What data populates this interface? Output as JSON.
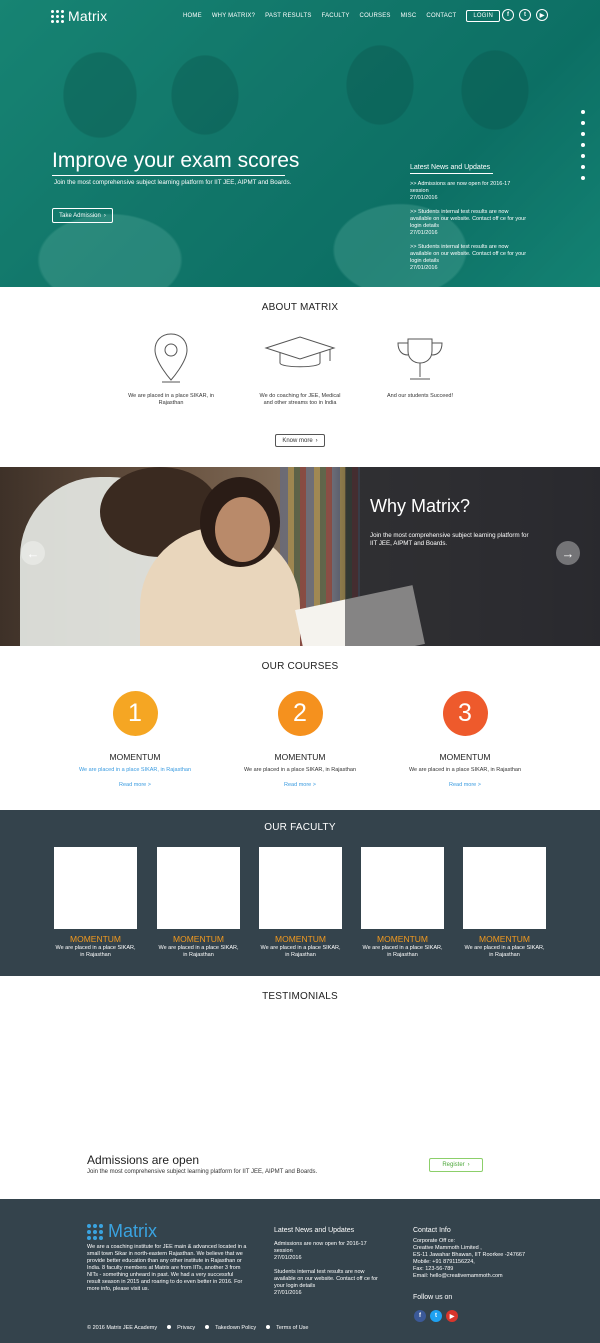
{
  "header": {
    "logo": "Matrix",
    "nav": [
      "HOME",
      "WHY MATRIX?",
      "PAST RESULTS",
      "FACULTY",
      "COURSES",
      "MISC",
      "CONTACT"
    ],
    "login": "LOGIN",
    "social": [
      "f",
      "t",
      "▶"
    ]
  },
  "hero": {
    "title": "Improve your exam scores",
    "subtitle": "Join the most comprehensive subject learning platform for IIT JEE, AIPMT and Boards.",
    "button": "Take Admission",
    "news_title": "Latest News and Updates",
    "news": [
      ">> Admissions are now open for 2016-17 session",
      "27/01/2016",
      ">> Students internal test results are now available on our website. Contact off ce for your login details",
      "27/01/2016",
      ">> Students internal test results are now available on our website. Contact off ce for your login details",
      "27/01/2016"
    ]
  },
  "about": {
    "title": "ABOUT MATRIX",
    "items": [
      "We are placed in a place SIKAR, in Rajasthan",
      "We do coaching for JEE, Medical and other streams too in India",
      "And our students Succeed!"
    ],
    "button": "Know more"
  },
  "why": {
    "title": "Why Matrix?",
    "subtitle": "Join the most comprehensive subject learning platform for IIT JEE, AIPMT and Boards."
  },
  "courses": {
    "title": "OUR COURSES",
    "items": [
      {
        "num": "1",
        "name": "MOMENTUM",
        "desc": "We are placed in a place SIKAR, in Rajasthan",
        "more": "Read more >",
        "color": "#f5a623"
      },
      {
        "num": "2",
        "name": "MOMENTUM",
        "desc": "We are placed in a place SIKAR, in Rajasthan",
        "more": "Read more >",
        "color": "#f5911e"
      },
      {
        "num": "3",
        "name": "MOMENTUM",
        "desc": "We are placed in a place SIKAR, in Rajasthan",
        "more": "Read more >",
        "color": "#ee5a2c"
      }
    ]
  },
  "faculty": {
    "title": "OUR FACULTY",
    "items": [
      {
        "name": "MOMENTUM",
        "desc": "We are placed in a place SIKAR, in Rajasthan"
      },
      {
        "name": "MOMENTUM",
        "desc": "We are placed in a place SIKAR, in Rajasthan"
      },
      {
        "name": "MOMENTUM",
        "desc": "We are placed in a place SIKAR, in Rajasthan"
      },
      {
        "name": "MOMENTUM",
        "desc": "We are placed in a place SIKAR, in Rajasthan"
      },
      {
        "name": "MOMENTUM",
        "desc": "We are placed in a place SIKAR, in Rajasthan"
      }
    ]
  },
  "testimonials": {
    "title": "TESTIMONIALS"
  },
  "admission": {
    "title": "Admissions are open",
    "subtitle": "Join the most comprehensive subject learning platform for IIT JEE, AIPMT and Boards.",
    "button": "Register"
  },
  "footer": {
    "logo": "Matrix",
    "about": "We are a coaching institute for JEE main & advanced located in a small town Sikar in north-eastern Rajasthan. We believe that we provide better education than any other institute in Rajasthan or India. 8 faculty members at Matrix are from IITs, another 3 from NITs - something unheard in past. We had a very successful result season in 2015 and roaring to do even better in 2016. For more info, please visit us.",
    "news_title": "Latest News and Updates",
    "news": [
      "Admissions are now open for 2016-17 session",
      "27/01/2016",
      "Students internal test results are now available on our website. Contact off ce for your login details",
      "27/01/2016"
    ],
    "contact_title": "Contact Info",
    "contact": [
      "Corporate Off ce:",
      "Creative Mammoth Limited ,",
      "ES-11 Jawahar Bhawan, IIT Roorkee -247667",
      "Mobile: +91 8791156224,",
      "Fax: 123-56-789",
      "Email: hello@creativemammoth.com"
    ],
    "follow": "Follow us on",
    "social": [
      "f",
      "t",
      "▶"
    ],
    "bottom": [
      "© 2016 Matrix JEE Academy",
      "Privacy",
      "Takedown Policy",
      "Terms of Use"
    ]
  },
  "colors": {
    "hero_teal": "#1a8878",
    "dark_panel": "#34434c",
    "accent_orange": "#f29a1f",
    "link_blue": "#3a9be0",
    "register_green": "#4ea83c"
  }
}
